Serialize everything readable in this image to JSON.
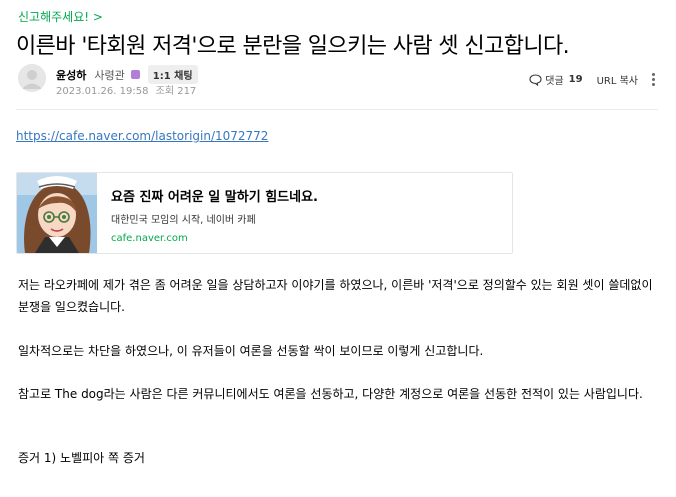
{
  "board_link": "신고해주세요! >",
  "post": {
    "title": "이른바 '타회원 저격'으로 분란을 일으키는 사람 셋 신고합니다.",
    "author": {
      "name": "윤성하",
      "role": "사령관",
      "chat_badge": "1:1 채팅"
    },
    "date": "2023.01.26. 19:58",
    "views": "조회 217"
  },
  "tools": {
    "comment_label": "댓글",
    "comment_count": "19",
    "copy_url_label": "URL 복사",
    "comment_icon": "speech-bubble-icon",
    "more_icon": "vertical-dots-icon"
  },
  "content": {
    "source_url": "https://cafe.naver.com/lastorigin/1072772",
    "og_card": {
      "title": "요즘 진짜 어려운 일 말하기 힘드네요.",
      "description": "대한민국 모임의 시작, 네이버 카페",
      "domain": "cafe.naver.com"
    },
    "paragraphs": [
      "저는 라오카페에 제가 겪은 좀 어려운 일을 상담하고자 이야기를 하였으나, 이른바 '저격'으로 정의할수 있는 회원 셋이 쓸데없이 분쟁을 일으켰습니다.",
      "일차적으로는 차단을 하였으나, 이 유저들이 여론을 선동할 싹이 보이므로 이렇게 신고합니다.",
      "참고로 The dog라는 사람은 다른 커뮤니티에서도 여론을 선동하고, 다양한 계정으로 여론을 선동한 전적이 있는 사람입니다.",
      "증거 1) 노벨피아 쪽 증거"
    ]
  },
  "colors": {
    "accent_green": "#03a94d",
    "link_blue": "#3777c2",
    "meta_gray": "#979797",
    "role_badge_purple": "#b07fd9"
  }
}
